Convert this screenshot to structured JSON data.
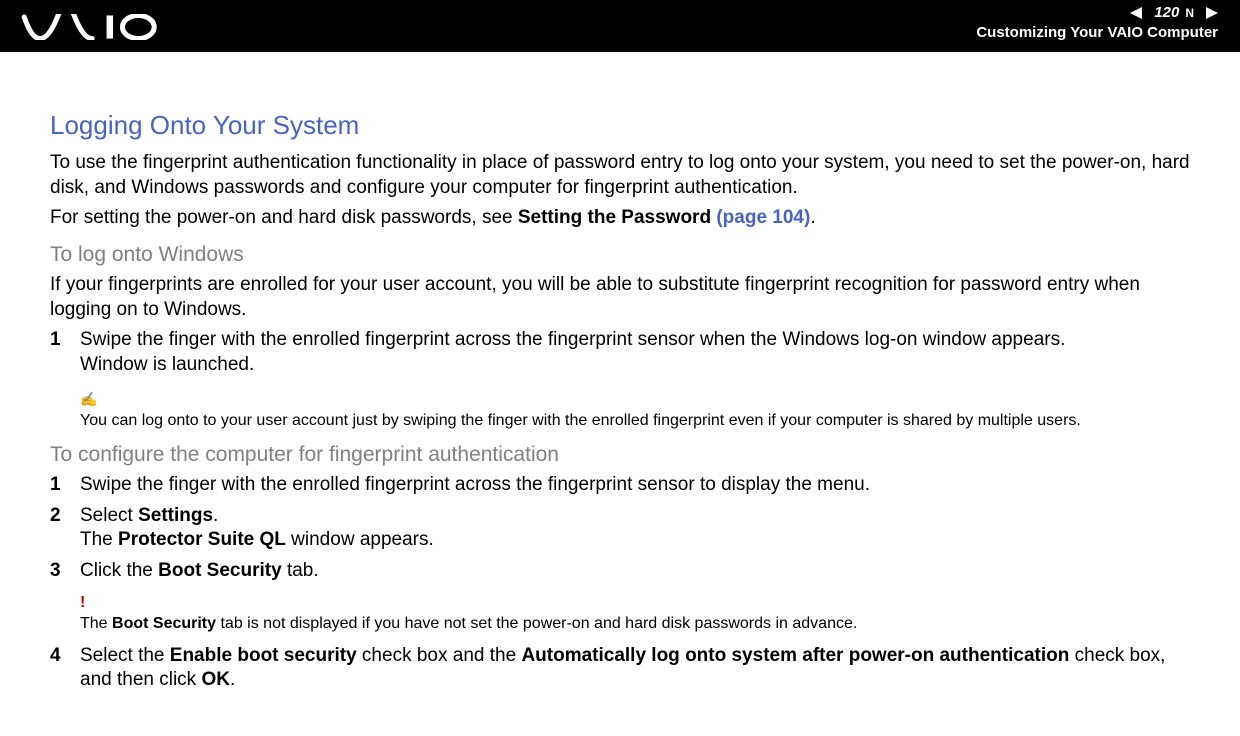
{
  "header": {
    "page_number": "120",
    "nav_letter": "N",
    "section_title": "Customizing Your VAIO Computer"
  },
  "content": {
    "title": "Logging Onto Your System",
    "intro1": "To use the fingerprint authentication functionality in place of password entry to log onto your system, you need to set the power-on, hard disk, and Windows passwords and configure your computer for fingerprint authentication.",
    "intro2_pre": "For setting the power-on and hard disk passwords, see ",
    "intro2_bold": "Setting the Password ",
    "intro2_link": "(page 104)",
    "intro2_post": ".",
    "sub1_title": "To log onto Windows",
    "sub1_para": "If your fingerprints are enrolled for your user account, you will be able to substitute fingerprint recognition for password entry when logging on to Windows.",
    "sub1_step1_num": "1",
    "sub1_step1_a": "Swipe the finger with the enrolled fingerprint across the fingerprint sensor when the Windows log-on window appears.",
    "sub1_step1_b": "Window is launched.",
    "note_icon": "✍",
    "note_text": "You can log onto to your user account just by swiping the finger with the enrolled fingerprint even if your computer is shared by multiple users.",
    "sub2_title": "To configure the computer for fingerprint authentication",
    "sub2_step1_num": "1",
    "sub2_step1": "Swipe the finger with the enrolled fingerprint across the fingerprint sensor to display the menu.",
    "sub2_step2_num": "2",
    "sub2_step2_a_pre": "Select ",
    "sub2_step2_a_bold": "Settings",
    "sub2_step2_a_post": ".",
    "sub2_step2_b_pre": "The ",
    "sub2_step2_b_bold": "Protector Suite QL",
    "sub2_step2_b_post": " window appears.",
    "sub2_step3_num": "3",
    "sub2_step3_pre": " Click the ",
    "sub2_step3_bold": "Boot Security",
    "sub2_step3_post": " tab.",
    "warn_icon": "!",
    "warn_pre": "The ",
    "warn_bold": "Boot Security",
    "warn_post": " tab is not displayed if you have not set the power-on and hard disk passwords in advance.",
    "sub2_step4_num": "4",
    "sub2_step4_pre": "Select the ",
    "sub2_step4_b1": "Enable boot security",
    "sub2_step4_mid1": " check box and the ",
    "sub2_step4_b2": "Automatically log onto system after power-on authentication",
    "sub2_step4_mid2": " check box, and then click ",
    "sub2_step4_b3": "OK",
    "sub2_step4_post": "."
  }
}
